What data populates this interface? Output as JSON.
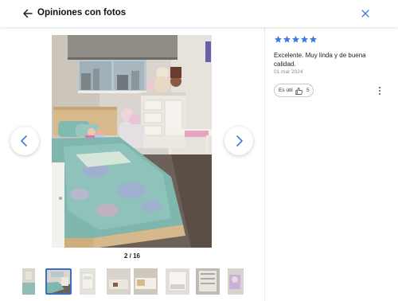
{
  "header": {
    "title": "Opiniones con fotos",
    "back_icon": "arrow-left-icon",
    "close_icon": "close-icon"
  },
  "gallery": {
    "counter": "2 / 16",
    "current": 2,
    "total": 16,
    "prev_icon": "chevron-left-icon",
    "next_icon": "chevron-right-icon",
    "thumbnails_visible": 9,
    "active_thumbnail": 2
  },
  "review": {
    "rating": 5,
    "rating_max": 5,
    "star_color": "#3b7ddd",
    "text": "Excelente. Muy linda y de buena calidad.",
    "date": "01 mar 2024",
    "useful_label": "Es útil",
    "useful_count": "5",
    "useful_icon": "thumbs-up-icon",
    "more_icon": "more-vertical-icon"
  },
  "colors": {
    "accent": "#3b7ddd",
    "active_thumb_border": "#3a6fc4"
  }
}
